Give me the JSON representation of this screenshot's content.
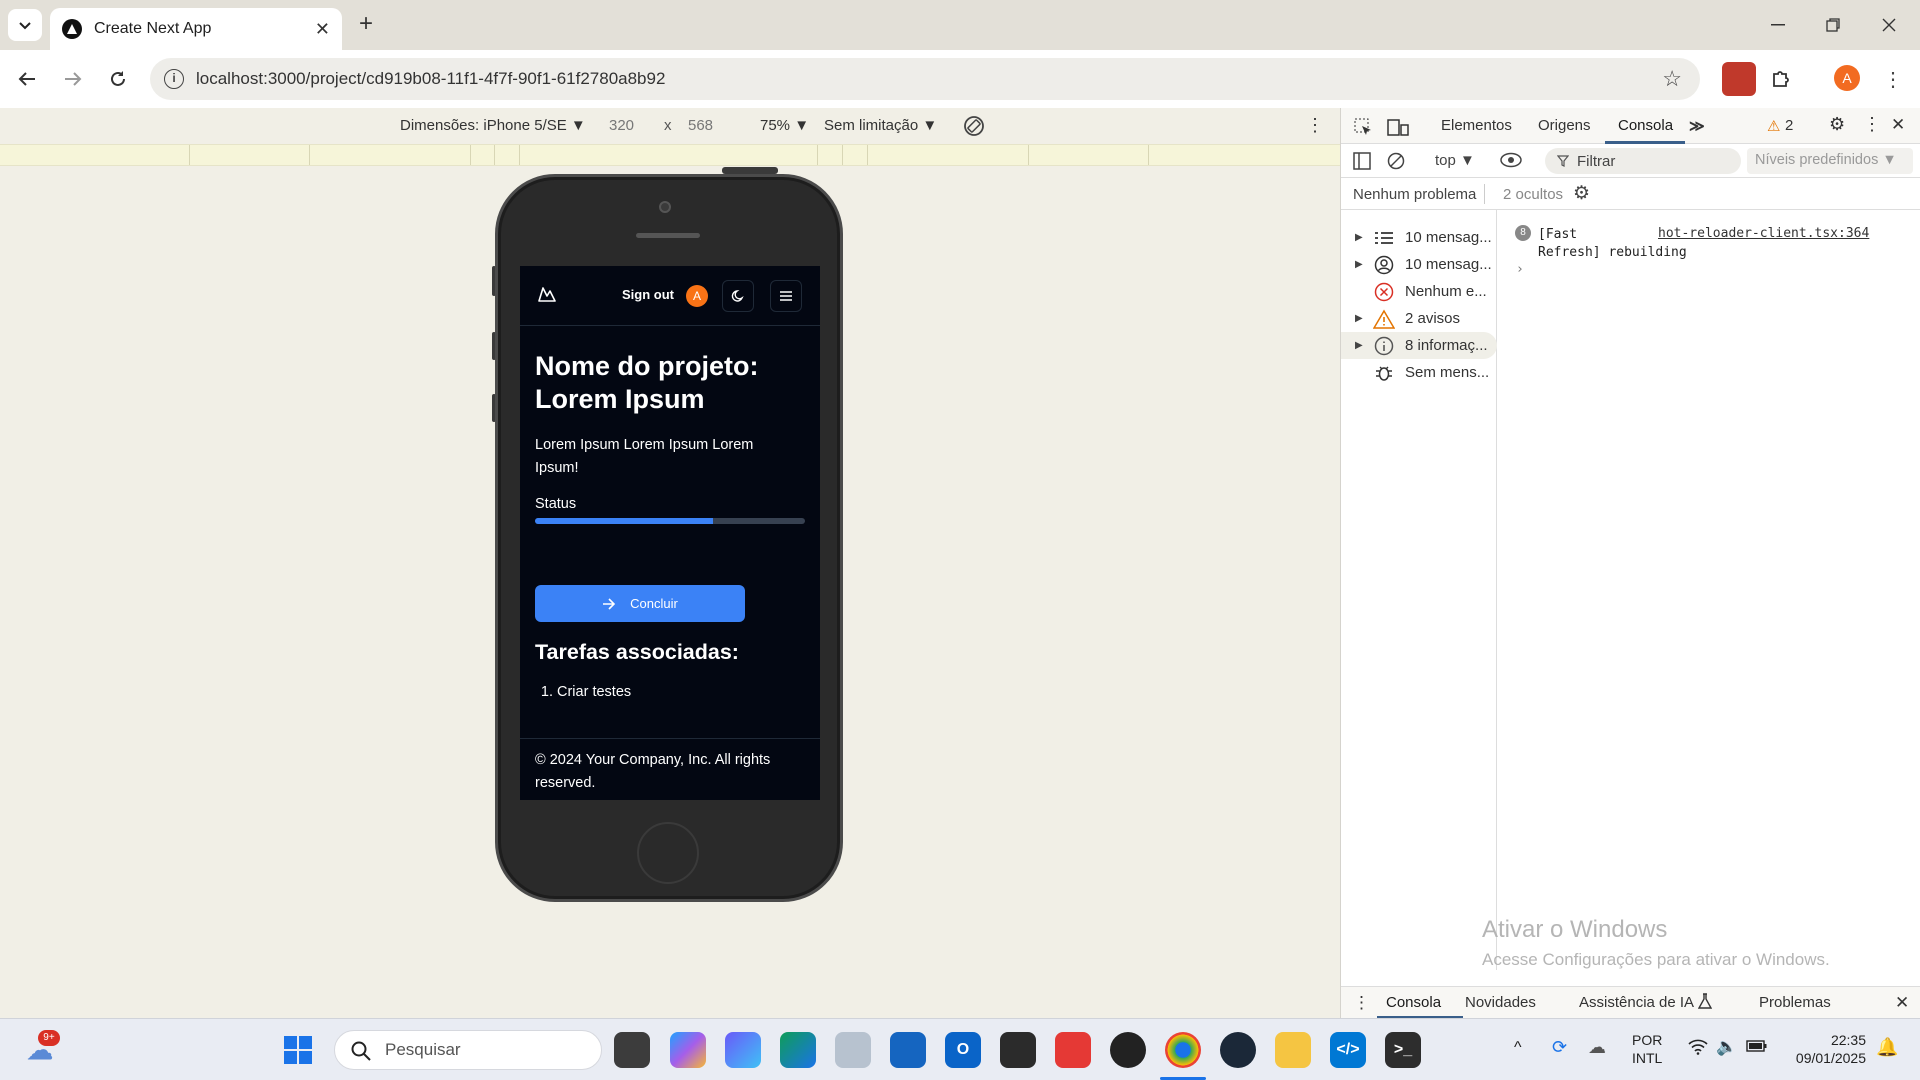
{
  "browser": {
    "tab_title": "Create Next App",
    "url": "localhost:3000/project/cd919b08-11f1-4f7f-90f1-61f2780a8b92",
    "profile_initial": "A"
  },
  "device_toolbar": {
    "device": "Dimensões: iPhone 5/SE ▼",
    "width": "320",
    "times": "x",
    "height": "568",
    "zoom": "75% ▼",
    "throttle": "Sem limitação ▼"
  },
  "app": {
    "sign_out": "Sign out",
    "avatar_initial": "A",
    "project_title": "Nome do projeto: Lorem Ipsum",
    "project_description": "Lorem Ipsum Lorem Ipsum Lorem Ipsum!",
    "status_label": "Status",
    "status_progress": 0.66,
    "conclude_label": "Concluir",
    "tasks_title": "Tarefas associadas:",
    "tasks": [
      "Criar testes"
    ],
    "footer": "© 2024 Your Company, Inc. All rights reserved."
  },
  "devtools": {
    "tabs": [
      "Elementos",
      "Origens",
      "Consola"
    ],
    "active_tab": "Consola",
    "warning_count": "2",
    "context": "top ▼",
    "filter_placeholder": "Filtrar",
    "levels": "Níveis predefinidos ▼",
    "issues": "Nenhum problema",
    "hidden": "2 ocultos",
    "sidebar": [
      {
        "label": "10 mensag...",
        "icon": "list-icon"
      },
      {
        "label": "10 mensag...",
        "icon": "user-icon"
      },
      {
        "label": "Nenhum e...",
        "icon": "error-icon"
      },
      {
        "label": "2 avisos",
        "icon": "warning-icon"
      },
      {
        "label": "8 informaç...",
        "icon": "info-icon"
      },
      {
        "label": "Sem mens...",
        "icon": "bug-icon"
      }
    ],
    "console_message_count": "8",
    "console_message": "[Fast Refresh] rebuilding",
    "console_message_line1": "[Fast",
    "console_message_line2": "Refresh] rebuilding",
    "console_source": "hot-reloader-client.tsx:364",
    "bottom_tabs": [
      "Consola",
      "Novidades",
      "Assistência de IA",
      "Problemas"
    ]
  },
  "watermark": {
    "title": "Ativar o Windows",
    "subtitle": "Acesse Configurações para ativar o Windows."
  },
  "taskbar": {
    "weather_badge": "9+",
    "search_placeholder": "Pesquisar",
    "lang_1": "POR",
    "lang_2": "INTL",
    "time": "22:35",
    "date": "09/01/2025"
  }
}
